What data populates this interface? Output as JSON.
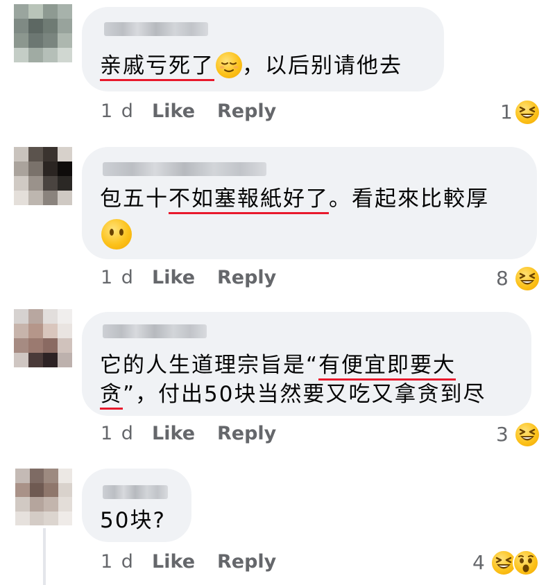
{
  "comments": [
    {
      "text_underlined": "亲戚亏死了",
      "text_rest": "，以后别请他去",
      "time": "1 d",
      "like_label": "Like",
      "reply_label": "Reply",
      "reaction_count": "1",
      "reactions": [
        "laughing-emoji"
      ]
    },
    {
      "text_before": "包五十",
      "text_underlined": "不如塞報紙好了",
      "text_after": "。看起來比較厚",
      "time": "1 d",
      "like_label": "Like",
      "reply_label": "Reply",
      "reaction_count": "8",
      "reactions": [
        "laughing-emoji"
      ]
    },
    {
      "text_before": "它的人生道理宗旨是“",
      "text_underlined_1": "有便宜即要大",
      "text_underlined_2": "贪",
      "text_after": "”，付出50块当然要又吃又拿贪到尽",
      "time": "1 d",
      "like_label": "Like",
      "reply_label": "Reply",
      "reaction_count": "3",
      "reactions": [
        "laughing-emoji"
      ]
    },
    {
      "text": "50块?",
      "time": "1 d",
      "like_label": "Like",
      "reply_label": "Reply",
      "reaction_count": "4",
      "reactions": [
        "laughing-emoji",
        "surprised-emoji"
      ]
    }
  ],
  "colors": {
    "bubble": "#f0f2f5",
    "meta_text": "#65676b",
    "underline": "#e8192c",
    "emoji_yellow": "#fcc21b"
  }
}
